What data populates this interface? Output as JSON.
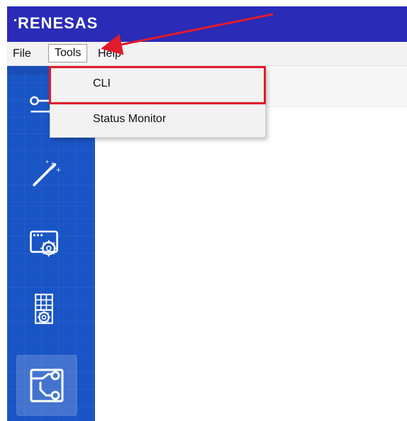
{
  "app": {
    "brand": "RENESAS"
  },
  "menubar": {
    "file": "File",
    "tools": "Tools",
    "help": "Help"
  },
  "tools_menu": {
    "items": [
      {
        "label": "CLI"
      },
      {
        "label": "Status Monitor"
      }
    ]
  },
  "colors": {
    "titlebar": "#2a2bb7",
    "leftnav": "#1a55c5",
    "annotation": "#e11b2b"
  },
  "icons": {
    "nav": [
      "connection-icon",
      "wand-icon",
      "window-settings-icon",
      "keypad-settings-icon",
      "board-icon"
    ]
  }
}
